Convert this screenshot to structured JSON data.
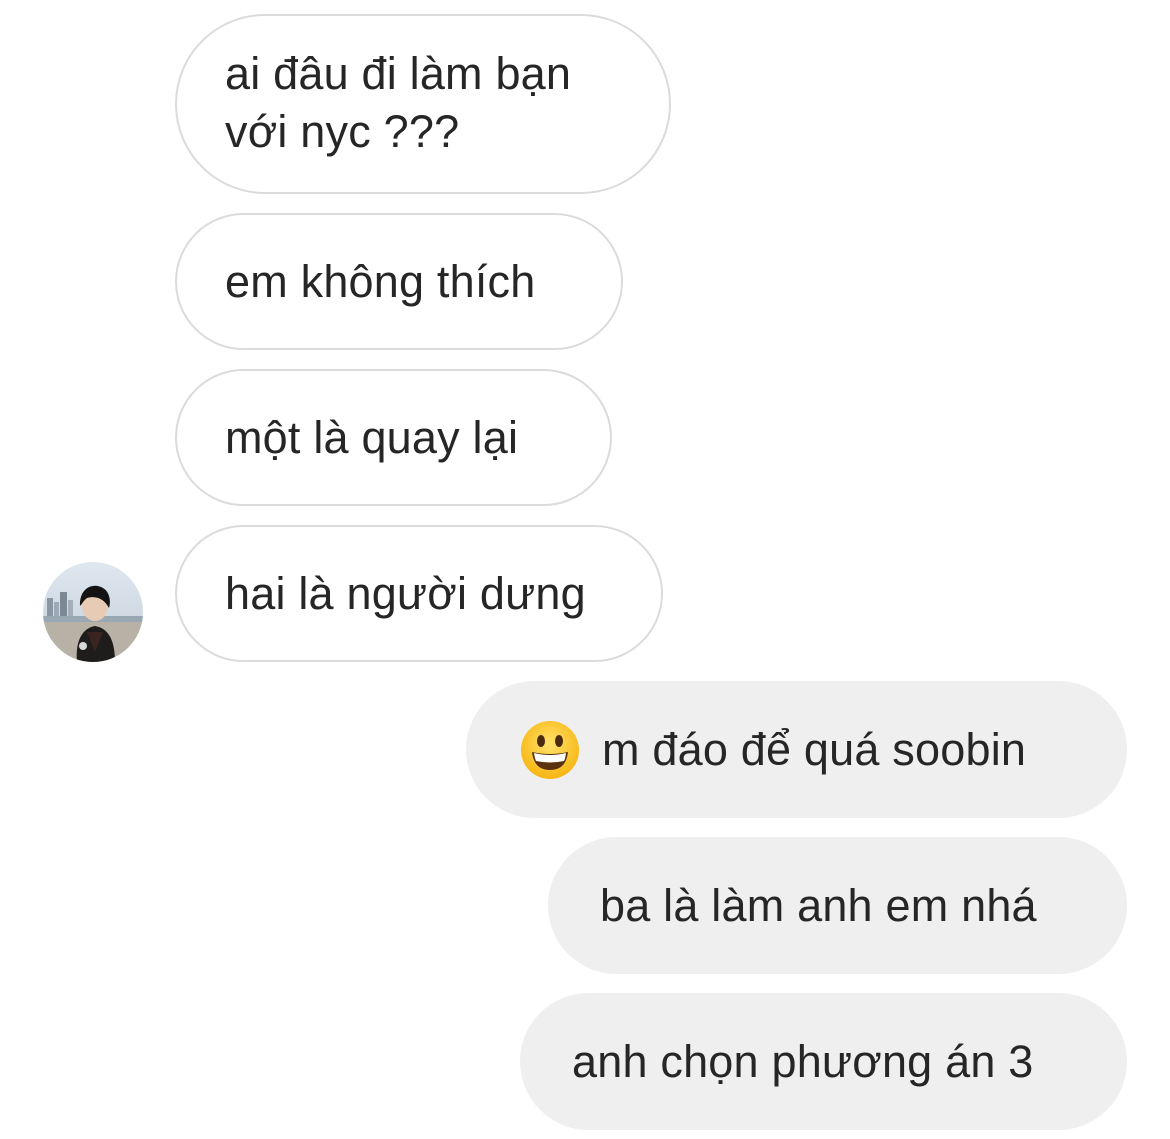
{
  "messages": {
    "incoming": [
      {
        "text": "ai đâu đi làm bạn với nyc ???"
      },
      {
        "text": "em không thích"
      },
      {
        "text": "một là quay lại"
      },
      {
        "text": "hai là người dưng"
      }
    ],
    "outgoing": [
      {
        "text": "m đáo để quá soobin",
        "emoji": "grinning-face-emoji"
      },
      {
        "text": "ba là làm anh em nhá"
      },
      {
        "text": "anh chọn phương án 3"
      }
    ]
  },
  "sender_avatar": {
    "icon": "profile-photo"
  },
  "colors": {
    "incoming_bubble_bg": "#ffffff",
    "incoming_bubble_border": "#dbdbdb",
    "outgoing_bubble_bg": "#efefef",
    "text": "#262626"
  }
}
